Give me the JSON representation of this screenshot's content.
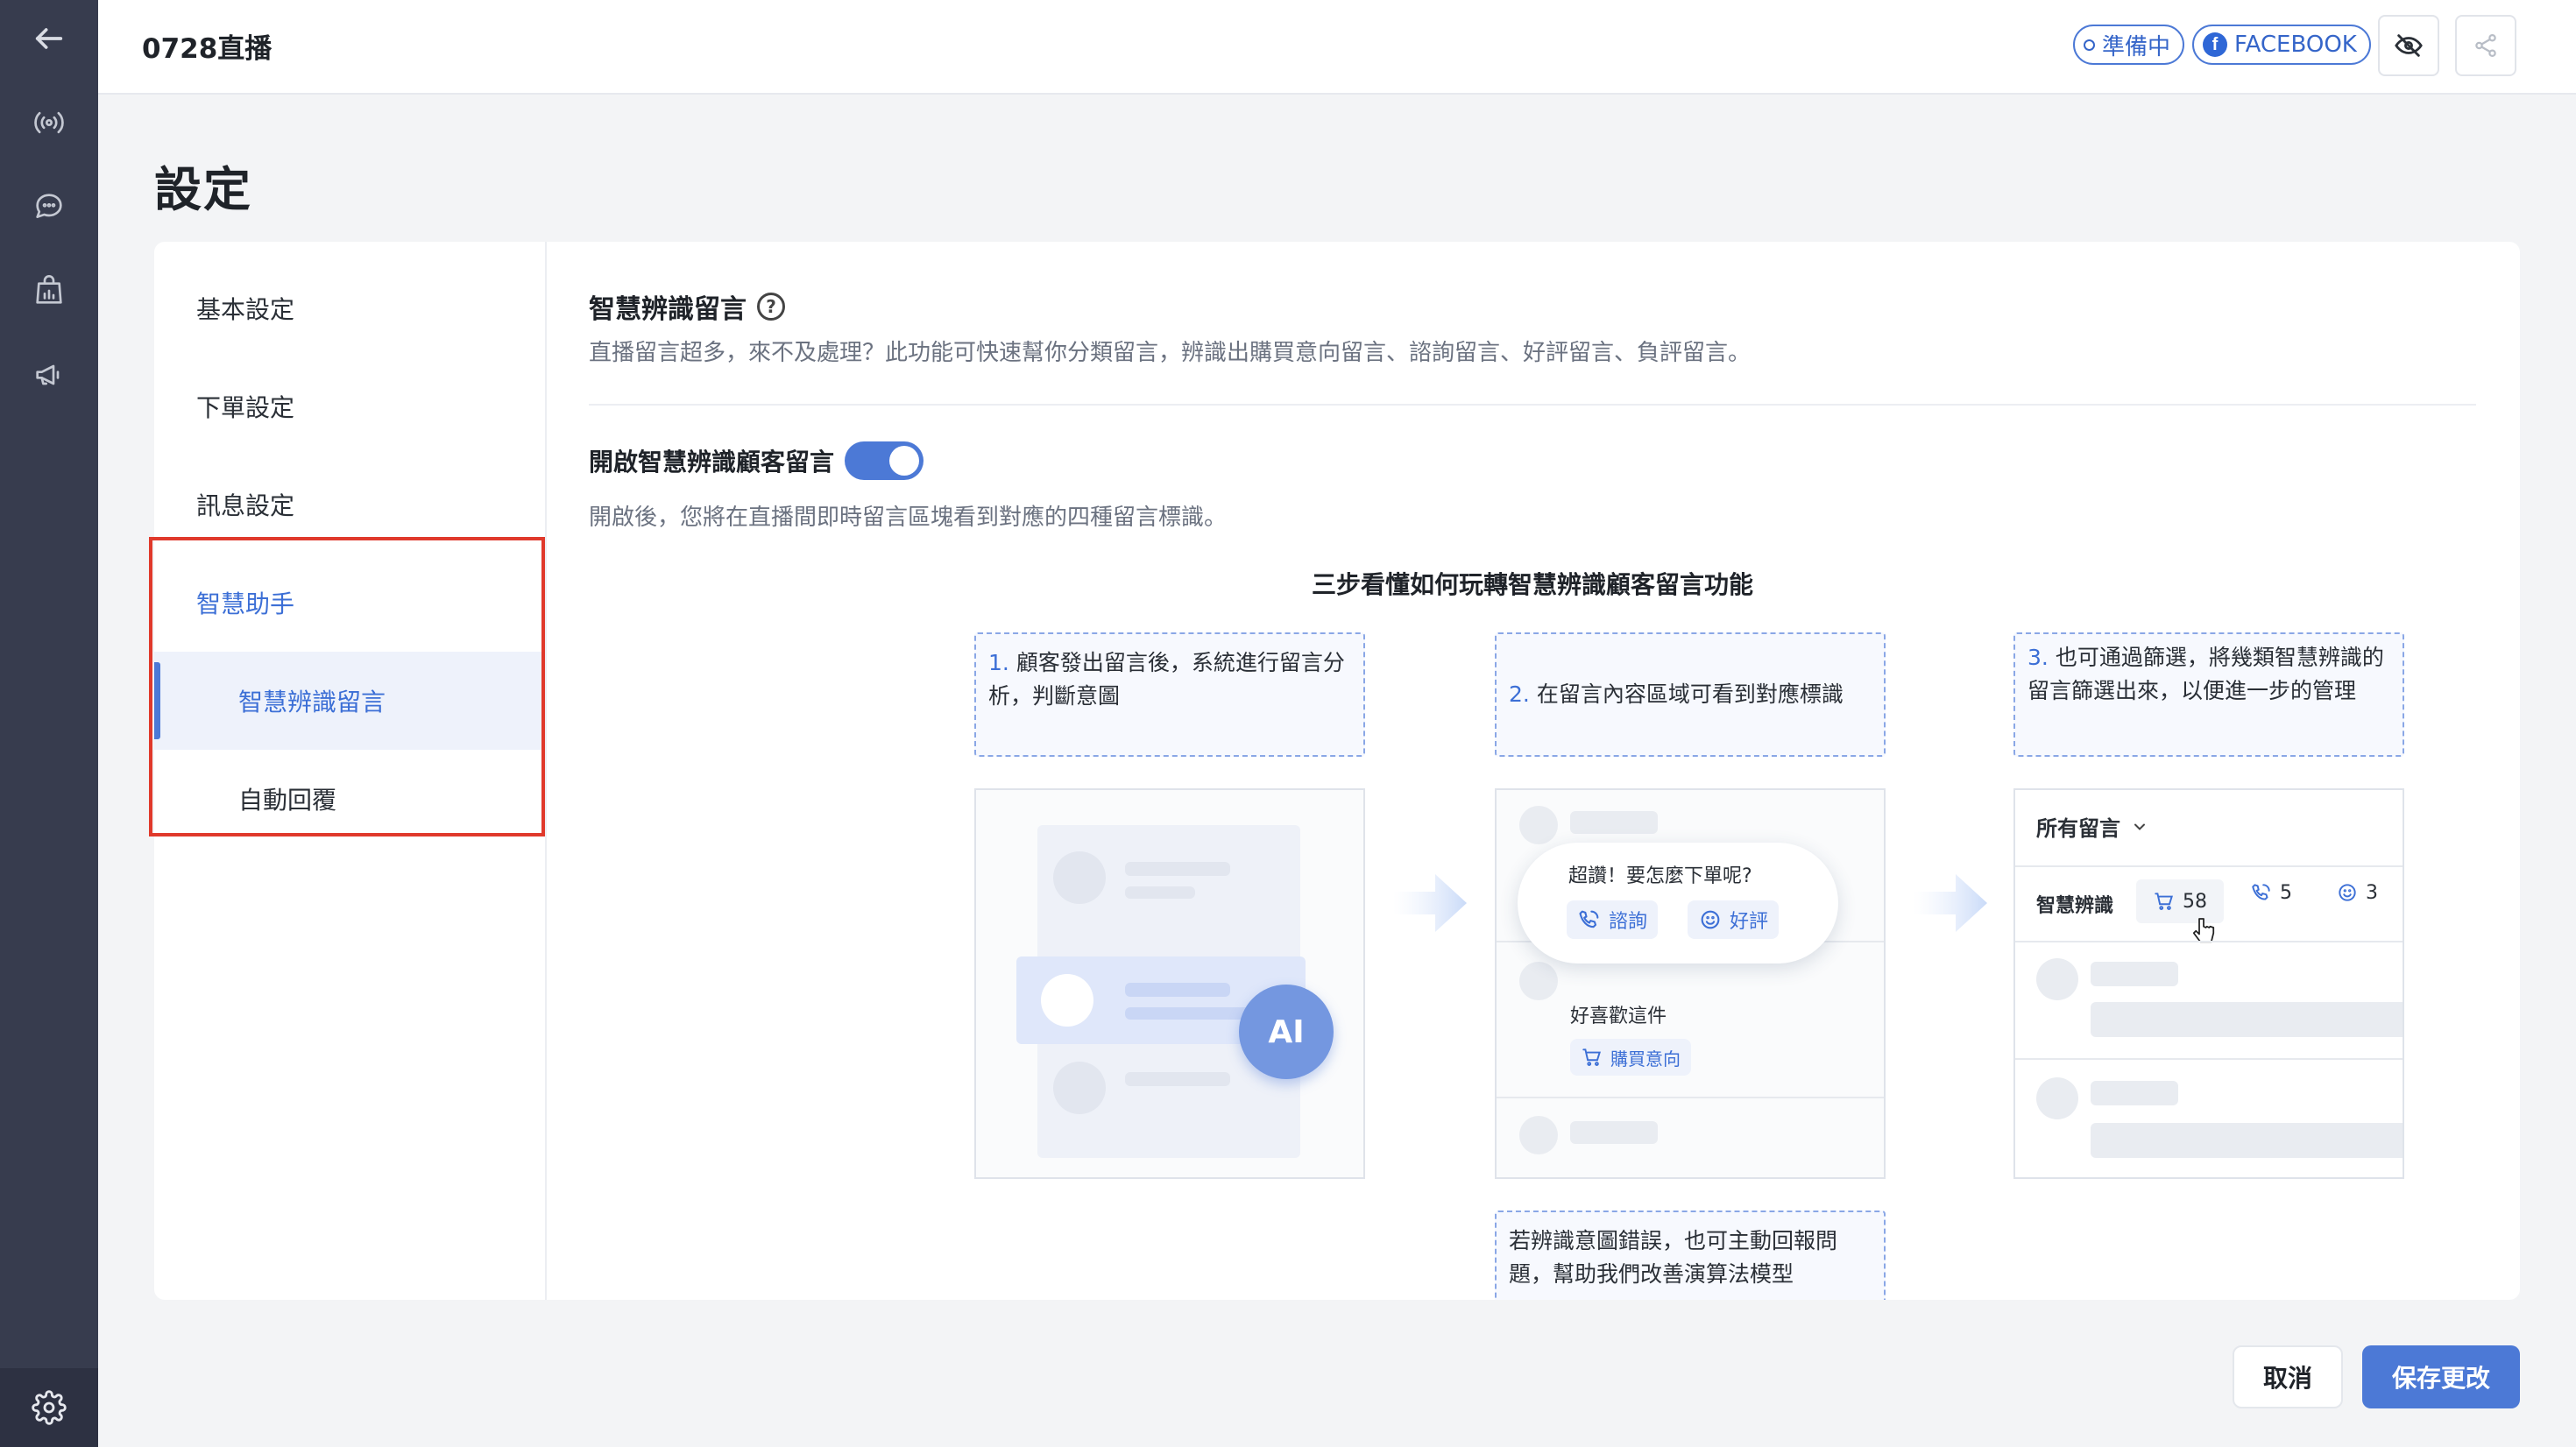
{
  "header": {
    "title": "0728直播",
    "status_pill": "準備中",
    "platform_pill": "FACEBOOK",
    "platform_icon": "f"
  },
  "page": {
    "title": "設定"
  },
  "subnav": {
    "items": [
      {
        "label": "基本設定"
      },
      {
        "label": "下單設定"
      },
      {
        "label": "訊息設定"
      },
      {
        "label": "智慧助手"
      },
      {
        "label": "智慧辨識留言"
      },
      {
        "label": "自動回覆"
      }
    ]
  },
  "section": {
    "title": "智慧辨識留言",
    "help_icon": "?",
    "description": "直播留言超多，來不及處理？此功能可快速幫你分類留言，辨識出購買意向留言、諮詢留言、好評留言、負評留言。",
    "toggle_label": "開啟智慧辨識顧客留言",
    "toggle_on": true,
    "toggle_description": "開啟後，您將在直播間即時留言區塊看到對應的四種留言標識。"
  },
  "guide": {
    "title": "三步看懂如何玩轉智慧辨識顧客留言功能",
    "steps": [
      {
        "num": "1.",
        "text": "顧客發出留言後，系統進行留言分析，判斷意圖"
      },
      {
        "num": "2.",
        "text": "在留言內容區域可看到對應標識"
      },
      {
        "num": "3.",
        "text": "也可通過篩選，將幾類智慧辨識的留言篩選出來，以便進一步的管理"
      }
    ],
    "note": "若辨識意圖錯誤，也可主動回報問題，幫助我們改善演算法模型",
    "ai_badge": "AI",
    "bubble_text": "超讚！要怎麼下單呢?",
    "tag_consult": "諮詢",
    "tag_praise": "好評",
    "comment_text": "好喜歡這件",
    "tag_purchase": "購買意向",
    "filter_dropdown": "所有留言",
    "filter_label": "智慧辨識",
    "count_purchase": "58",
    "count_consult": "5",
    "count_praise": "3"
  },
  "footer": {
    "cancel": "取消",
    "save": "保存更改"
  },
  "colors": {
    "accent": "#4c79d6",
    "rail": "#373c4e",
    "highlight": "#e0392b"
  }
}
